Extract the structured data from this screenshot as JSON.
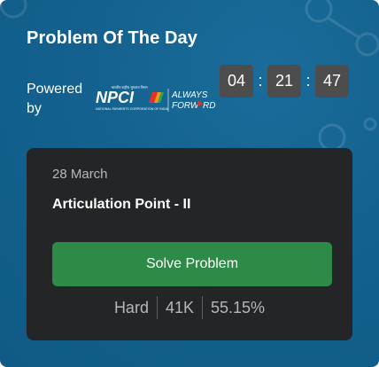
{
  "header": {
    "title": "Problem Of The Day",
    "powered_by": "Powered by",
    "sponsor_logo": {
      "name": "NPCI",
      "tagline": "ALWAYS FORWARD",
      "fine_print": "NATIONAL PAYMENTS CORPORATION OF INDIA"
    }
  },
  "timer": {
    "hours": "04",
    "minutes": "21",
    "seconds": "47",
    "separator": ":"
  },
  "problem": {
    "date": "28 March",
    "name": "Articulation Point - II",
    "button_label": "Solve Problem",
    "difficulty": "Hard",
    "submissions": "41K",
    "accuracy": "55.15%"
  },
  "colors": {
    "background": "#14618f",
    "timer_box": "#4d4d4d",
    "card": "#232527",
    "button": "#2e8b47",
    "logo_red": "#e33324",
    "logo_text": "#ffffff"
  }
}
